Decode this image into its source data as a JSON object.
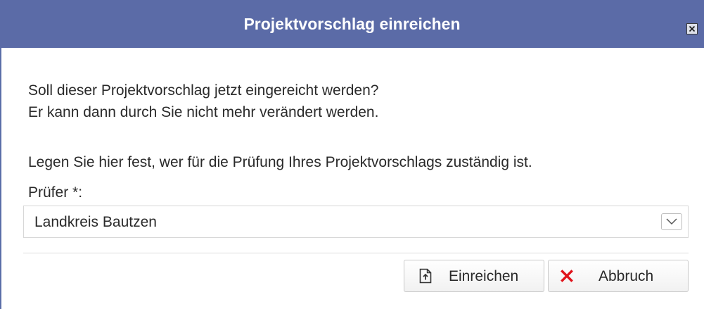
{
  "dialog": {
    "title": "Projektvorschlag einreichen",
    "close_icon": "close-icon",
    "message_line1": "Soll dieser Projektvorschlag jetzt eingereicht werden?",
    "message_line2": "Er kann dann durch Sie nicht mehr verändert werden.",
    "instruction": "Legen Sie hier fest, wer für die Prüfung Ihres Projektvorschlags zuständig ist.",
    "reviewer_label": "Prüfer *:",
    "reviewer_value": "Landkreis Bautzen",
    "buttons": {
      "submit_label": "Einreichen",
      "submit_icon": "file-upload-icon",
      "cancel_label": "Abbruch",
      "cancel_icon": "x-icon"
    }
  },
  "colors": {
    "titlebar": "#5b6ba7",
    "cancel_icon": "#e0141c"
  }
}
